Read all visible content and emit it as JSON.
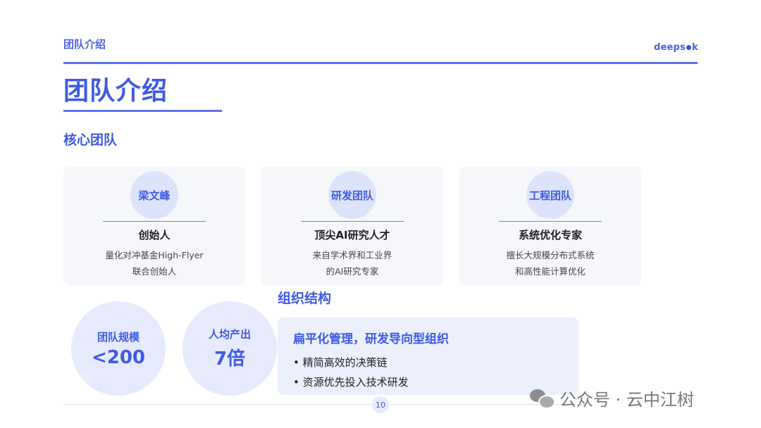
{
  "header": {
    "section_label": "团队介绍",
    "brand_prefix": "deeps",
    "brand_suffix": "k"
  },
  "title": "团队介绍",
  "core_team": {
    "heading": "核心团队",
    "cards": [
      {
        "name": "梁文峰",
        "role": "创始人",
        "desc": [
          "量化对冲基金High-Flyer",
          "联合创始人"
        ]
      },
      {
        "name": "研发团队",
        "role": "顶尖AI研究人才",
        "desc": [
          "来自学术界和工业界",
          "的AI研究专家"
        ]
      },
      {
        "name": "工程团队",
        "role": "系统优化专家",
        "desc": [
          "擅长大规模分布式系统",
          "和高性能计算优化"
        ]
      }
    ]
  },
  "stats": [
    {
      "label": "团队规模",
      "value": "<200"
    },
    {
      "label": "人均产出",
      "value": "7倍"
    }
  ],
  "org": {
    "heading": "组织结构",
    "headline": "扁平化管理，研发导向型组织",
    "bullets": [
      "精简高效的决策链",
      "资源优先投入技术研发"
    ]
  },
  "page_number": "10",
  "watermark": "公众号 · 云中江树",
  "colors": {
    "accent": "#3e5ae4",
    "card_bg": "#f6f7fb",
    "circle_bg": "#e6eafc"
  }
}
